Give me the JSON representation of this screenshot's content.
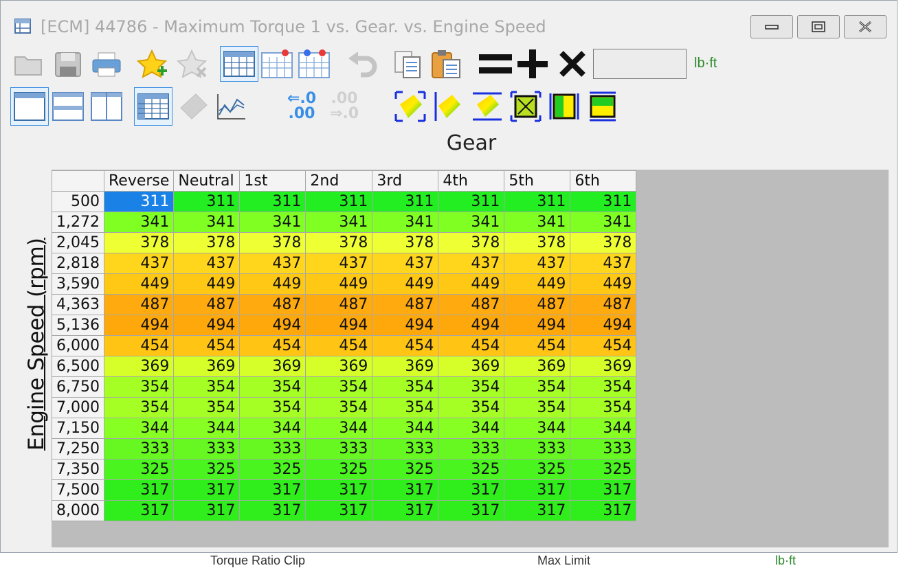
{
  "window": {
    "title": "[ECM] 44786 - Maximum Torque 1 vs. Gear. vs. Engine Speed"
  },
  "toolbar": {
    "value_placeholder": "",
    "unit": "lb·ft",
    "icons_row1": [
      "open-icon",
      "save-icon",
      "print-icon",
      "add-favorite-icon",
      "remove-favorite-icon",
      "table-view-icon",
      "table-add-icon",
      "table-compare-icon",
      "undo-icon",
      "copy-icon",
      "paste-icon",
      "equals-icon",
      "plus-icon",
      "multiply-icon"
    ],
    "icons_row2": [
      "single-pane-icon",
      "horizontal-split-icon",
      "vertical-split-icon",
      "table-grid-icon",
      "3d-graph-icon",
      "line-graph-icon",
      "decimal-increase-icon",
      "decimal-decrease-icon",
      "select-all-graph-icon",
      "fill-left-icon",
      "fill-bottom-icon",
      "interpolate-icon",
      "fill-horizontal-icon",
      "fill-vertical-icon"
    ],
    "decimal_increase": ".0",
    "decimal_increase_b": ".00",
    "decimal_decrease": ".00",
    "decimal_decrease_b": ".0"
  },
  "table": {
    "x_axis_label": "Gear",
    "y_axis_label": "Engine Speed (rpm)",
    "columns": [
      "Reverse",
      "Neutral",
      "1st",
      "2nd",
      "3rd",
      "4th",
      "5th",
      "6th"
    ],
    "rows": [
      {
        "rpm": "500",
        "value": "311",
        "color": "#22ee22"
      },
      {
        "rpm": "1,272",
        "value": "341",
        "color": "#7fff22"
      },
      {
        "rpm": "2,045",
        "value": "378",
        "color": "#eeff33"
      },
      {
        "rpm": "2,818",
        "value": "437",
        "color": "#ffd61c"
      },
      {
        "rpm": "3,590",
        "value": "449",
        "color": "#ffc814"
      },
      {
        "rpm": "4,363",
        "value": "487",
        "color": "#ffaa0e"
      },
      {
        "rpm": "5,136",
        "value": "494",
        "color": "#ffa80c"
      },
      {
        "rpm": "6,000",
        "value": "454",
        "color": "#ffc414"
      },
      {
        "rpm": "6,500",
        "value": "369",
        "color": "#d6ff2a"
      },
      {
        "rpm": "6,750",
        "value": "354",
        "color": "#a6ff24"
      },
      {
        "rpm": "7,000",
        "value": "354",
        "color": "#a6ff24"
      },
      {
        "rpm": "7,150",
        "value": "344",
        "color": "#88ff22"
      },
      {
        "rpm": "7,250",
        "value": "333",
        "color": "#66f820"
      },
      {
        "rpm": "7,350",
        "value": "325",
        "color": "#4af41e"
      },
      {
        "rpm": "7,500",
        "value": "317",
        "color": "#30ee1c"
      },
      {
        "rpm": "8,000",
        "value": "317",
        "color": "#30ee1c"
      }
    ],
    "selected_color": "#1a82e6"
  },
  "background_window": {
    "fragment_left": "Torque Ratio Clip",
    "fragment_mid": "Max Limit",
    "fragment_right": "lb·ft"
  }
}
